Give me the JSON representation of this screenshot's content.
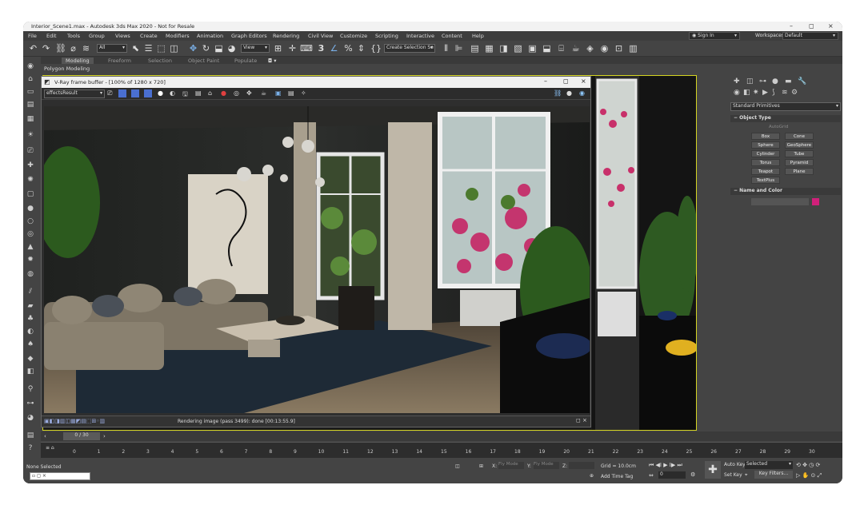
{
  "window": {
    "title": "Interior_Scene1.max - Autodesk 3ds Max 2020 - Not for Resale",
    "controls": [
      "–",
      "◻",
      "×"
    ]
  },
  "menu": [
    "File",
    "Edit",
    "Tools",
    "Group",
    "Views",
    "Create",
    "Modifiers",
    "Animation",
    "Graph Editors",
    "Rendering",
    "Civil View",
    "Customize",
    "Scripting",
    "Interactive",
    "Content",
    "Help"
  ],
  "signin": "Sign In",
  "workspaces_label": "Workspaces:",
  "workspace_value": "Default",
  "toolbar": {
    "filter": "All",
    "view": "View",
    "selection_set": "Create Selection Se",
    "snap_value": "3"
  },
  "ribbon": {
    "tabs": [
      "Modeling",
      "Freeform",
      "Selection",
      "Object Paint",
      "Populate"
    ],
    "sub": "Polygon Modeling"
  },
  "vfb": {
    "title": "V-Ray frame buffer - [100% of 1280 x 720]",
    "channel": "effectsResult",
    "status": "Rendering image (pass 3499): done [00:13:55.9]"
  },
  "command_panel": {
    "category": "Standard Primitives",
    "object_type_title": "Object Type",
    "autogrid": "AutoGrid",
    "buttons": [
      "Box",
      "Cone",
      "Sphere",
      "GeoSphere",
      "Cylinder",
      "Tube",
      "Torus",
      "Pyramid",
      "Teapot",
      "Plane",
      "TextPlus"
    ],
    "name_color_title": "Name and Color",
    "color": "#d0207a"
  },
  "timeline": {
    "frame": "0 / 30",
    "ticks": [
      "0",
      "1",
      "2",
      "3",
      "4",
      "5",
      "6",
      "7",
      "8",
      "9",
      "10",
      "11",
      "12",
      "13",
      "14",
      "15",
      "16",
      "17",
      "18",
      "19",
      "20",
      "21",
      "22",
      "23",
      "24",
      "25",
      "26",
      "27",
      "28",
      "29",
      "30"
    ]
  },
  "bottom": {
    "status": "None Selected",
    "x_label": "X:",
    "x_value": "Fly Mode",
    "y_label": "Y:",
    "y_value": "Fly Mode",
    "z_label": "Z:",
    "grid": "Grid = 10.0cm",
    "add_time_tag": "Add Time Tag",
    "auto_key": "Auto Key",
    "selected": "Selected",
    "set_key": "Set Key",
    "key_filters": "Key Filters...",
    "frame_value": "0"
  }
}
